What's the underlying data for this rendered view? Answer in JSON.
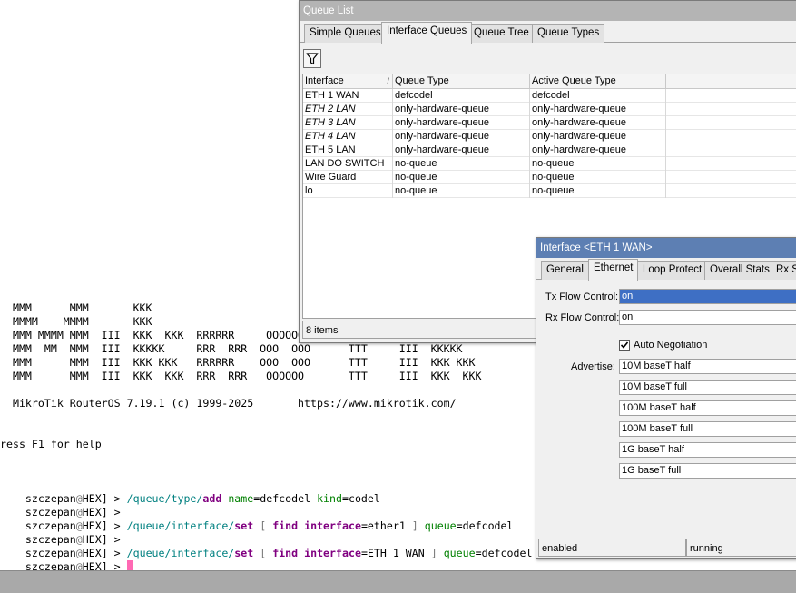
{
  "terminal": {
    "banner": [
      "  MMM      MMM       KKK",
      "  MMMM    MMMM       KKK",
      "  MMM MMMM MMM  III  KKK  KKK  RRRRRR     OOOOOO",
      "  MMM  MM  MMM  III  KKKKK     RRR  RRR  OOO  OOO      TTT     III  KKKKK",
      "  MMM      MMM  III  KKK KKK   RRRRRR    OOO  OOO      TTT     III  KKK KKK",
      "  MMM      MMM  III  KKK  KKK  RRR  RRR   OOOOOO       TTT     III  KKK  KKK"
    ],
    "version_line": "  MikroTik RouterOS 7.19.1 (c) 1999-2025       https://www.mikrotik.com/",
    "help_line": "ress F1 for help",
    "prompt_user": "szczepan",
    "prompt_at": "@",
    "prompt_host": "HEX",
    "prompt_tail": "] > ",
    "commands": [
      {
        "path": "/queue/type/",
        "verb": "add",
        "args": [
          {
            "k": "name",
            "v": "defcodel"
          },
          {
            "k": "kind",
            "v": "codel"
          }
        ]
      },
      {
        "path": "",
        "verb": "",
        "args": []
      },
      {
        "path": "/queue/interface/",
        "verb": "set",
        "find": "ether1",
        "q": "defcodel"
      },
      {
        "path": "",
        "verb": "",
        "args": []
      },
      {
        "path": "/queue/interface/",
        "verb": "set",
        "find": "ETH 1 WAN",
        "q": "defcodel"
      },
      {
        "path": "",
        "verb": "",
        "args": [],
        "cursor": true
      }
    ]
  },
  "queue_list": {
    "title": "Queue List",
    "tabs": [
      "Simple Queues",
      "Interface Queues",
      "Queue Tree",
      "Queue Types"
    ],
    "active_tab": 1,
    "columns": [
      "Interface",
      "Queue Type",
      "Active Queue Type"
    ],
    "sort_indicator": "/",
    "rows": [
      {
        "interface": "ETH 1 WAN",
        "queue_type": "defcodel",
        "active_queue_type": "defcodel",
        "italic": false
      },
      {
        "interface": "ETH 2 LAN",
        "queue_type": "only-hardware-queue",
        "active_queue_type": "only-hardware-queue",
        "italic": true
      },
      {
        "interface": "ETH 3 LAN",
        "queue_type": "only-hardware-queue",
        "active_queue_type": "only-hardware-queue",
        "italic": true
      },
      {
        "interface": "ETH 4 LAN",
        "queue_type": "only-hardware-queue",
        "active_queue_type": "only-hardware-queue",
        "italic": true
      },
      {
        "interface": "ETH 5 LAN",
        "queue_type": "only-hardware-queue",
        "active_queue_type": "only-hardware-queue",
        "italic": false
      },
      {
        "interface": "LAN DO SWITCH",
        "queue_type": "no-queue",
        "active_queue_type": "no-queue",
        "italic": false
      },
      {
        "interface": "Wire Guard",
        "queue_type": "no-queue",
        "active_queue_type": "no-queue",
        "italic": false
      },
      {
        "interface": "lo",
        "queue_type": "no-queue",
        "active_queue_type": "no-queue",
        "italic": false
      }
    ],
    "status": "8 items"
  },
  "interface_window": {
    "title": "Interface <ETH 1 WAN>",
    "tabs": [
      "General",
      "Ethernet",
      "Loop Protect",
      "Overall Stats",
      "Rx S"
    ],
    "active_tab": 1,
    "tx_flow_label": "Tx Flow Control:",
    "tx_flow_value": "on",
    "rx_flow_label": "Rx Flow Control:",
    "rx_flow_value": "on",
    "auto_negotiation_label": "Auto Negotiation",
    "auto_negotiation_checked": true,
    "advertise_label": "Advertise:",
    "advertise_options": [
      "10M baseT half",
      "10M baseT full",
      "100M baseT half",
      "100M baseT full",
      "1G baseT half",
      "1G baseT full"
    ],
    "status_left": "enabled",
    "status_right": "running"
  },
  "colors": {
    "inactive_title": "#b4b4b4",
    "active_title": "#5d7fb3",
    "selection": "#3e6fc4",
    "cursor": "#ff69b4",
    "terminal_path": "#008080",
    "terminal_keyword": "#800080"
  }
}
